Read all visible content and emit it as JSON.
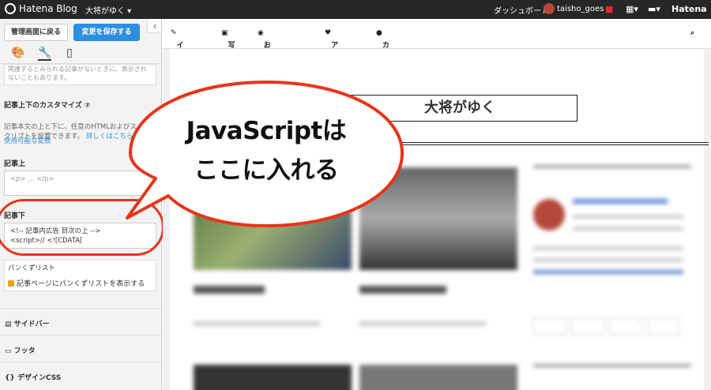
{
  "topbar": {
    "logo": "Hatena Blog",
    "blog_name": "大将がゆく ▾",
    "dashboard": "ダッシュボード",
    "user": "taisho_goes ▾",
    "brand": "Hatena"
  },
  "sidebar": {
    "back_button": "管理画面に戻る",
    "save_button": "変更を保存する",
    "collapse": "‹",
    "note_text": "関連するとみられる記事がないときに、表示されないこともあります。",
    "article_customize_title": "記事上下のカスタマイズ ⑦",
    "article_customize_desc": "記事本文の上と下に、任意のHTMLおよびスクリプトを設置できます。",
    "details_link": "詳しくはこちら",
    "variables_link": "使用可能な変数",
    "above_label": "記事上",
    "above_value": "<p> ... </p>",
    "below_label": "記事下",
    "below_value_line1": "<!-- 記事内広告 目次の上 -->",
    "below_value_line2": "<script>// <![CDATA[",
    "breadcrumb_title": "パンくずリスト",
    "breadcrumb_checkbox": "記事ページにパンくずリストを表示する",
    "menu_sidebar": "サイドバー",
    "menu_footer": "フッタ",
    "menu_design_css": "デザインCSS"
  },
  "nav": {
    "items": [
      "イラスト",
      "写真",
      "おでかけ日記",
      "アイテム",
      "カテゴリー一覧"
    ]
  },
  "blog": {
    "title": "大将がゆく"
  },
  "callout": {
    "line1": "JavaScriptは",
    "line2": "ここに入れる"
  },
  "colors": {
    "accent": "#2e8ee0",
    "callout_border": "#e8341c"
  }
}
